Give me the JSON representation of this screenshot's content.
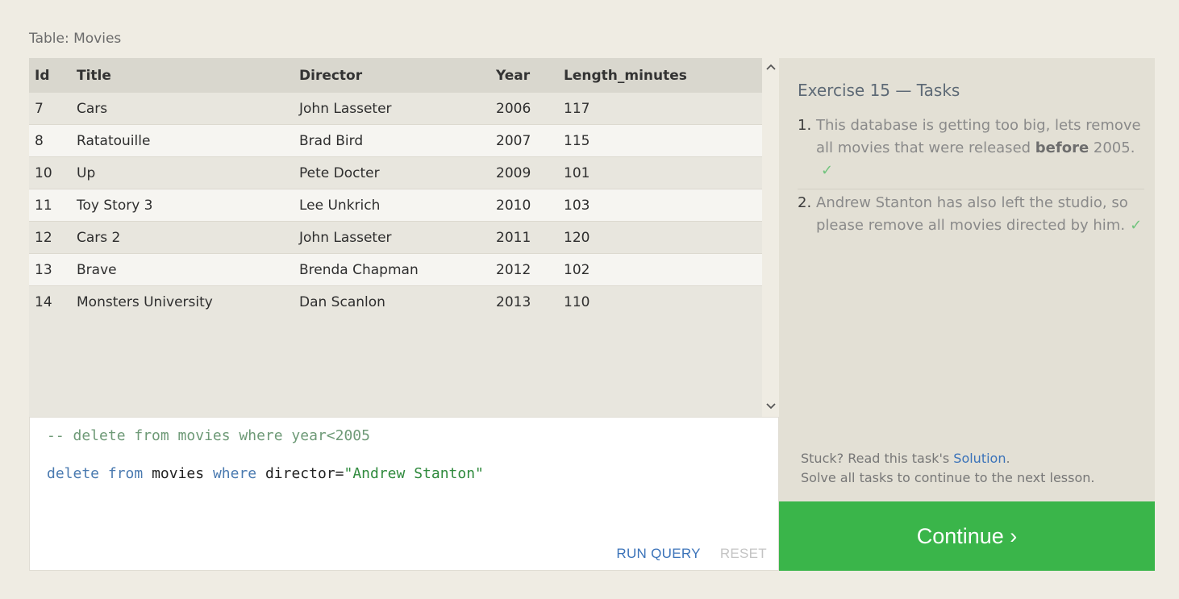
{
  "table": {
    "caption": "Table: Movies",
    "columns": [
      "Id",
      "Title",
      "Director",
      "Year",
      "Length_minutes"
    ],
    "rows": [
      [
        "7",
        "Cars",
        "John Lasseter",
        "2006",
        "117"
      ],
      [
        "8",
        "Ratatouille",
        "Brad Bird",
        "2007",
        "115"
      ],
      [
        "10",
        "Up",
        "Pete Docter",
        "2009",
        "101"
      ],
      [
        "11",
        "Toy Story 3",
        "Lee Unkrich",
        "2010",
        "103"
      ],
      [
        "12",
        "Cars 2",
        "John Lasseter",
        "2011",
        "120"
      ],
      [
        "13",
        "Brave",
        "Brenda Chapman",
        "2012",
        "102"
      ],
      [
        "14",
        "Monsters University",
        "Dan Scanlon",
        "2013",
        "110"
      ]
    ]
  },
  "editor": {
    "line1": "-- delete from movies where year<2005",
    "line2": {
      "kw1": "delete",
      "sp1": " ",
      "kw2": "from",
      "plain1": " movies ",
      "kw3": "where",
      "plain2": " director=",
      "str": "\"Andrew Stanton\""
    },
    "run_label": "RUN QUERY",
    "reset_label": "RESET"
  },
  "tasks": {
    "title": "Exercise 15 — Tasks",
    "items": [
      {
        "num": "1.",
        "before": "This database is getting too big, lets remove all movies that were released ",
        "bold": "before",
        "after": " 2005.",
        "check": "✓"
      },
      {
        "num": "2.",
        "text": "Andrew Stanton has also left the studio, so please remove all movies directed by him.",
        "check": "✓"
      }
    ],
    "help_prefix": "Stuck? Read this task's ",
    "help_link": "Solution",
    "help_suffix": ".",
    "help_line2": "Solve all tasks to continue to the next lesson."
  },
  "continue_label": "Continue ›",
  "icons": {
    "scroll_up": "chevron-up-icon",
    "scroll_down": "chevron-down-icon"
  }
}
